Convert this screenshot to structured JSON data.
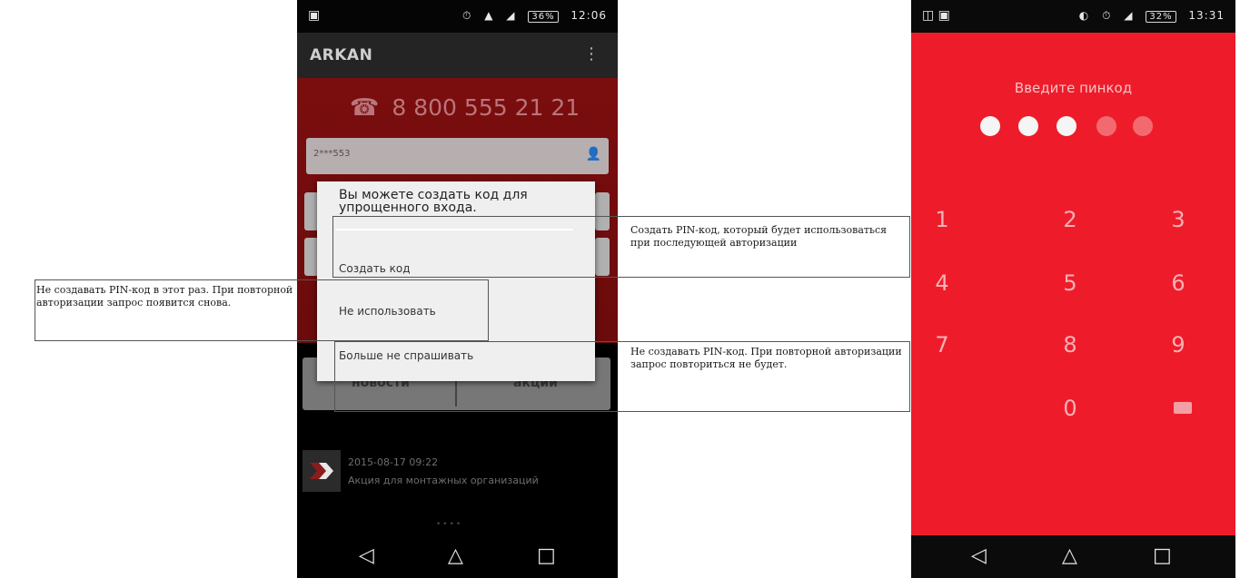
{
  "left_phone": {
    "status_bar": {
      "left_icon": "▣",
      "icons": [
        "⏱",
        "▲",
        "◢"
      ],
      "battery": "36%",
      "time": "12:06"
    },
    "app_bar": {
      "title": "ARKAN",
      "menu_icon": "⋮"
    },
    "phone_number": "8 800 555 21 21",
    "login_value": "2***553",
    "dialog": {
      "message": "Вы можете создать код для упрощенного входа.",
      "options": [
        "Создать код",
        "Не использовать",
        "Больше не спрашивать"
      ]
    },
    "tabs": [
      "новости",
      "акции"
    ],
    "news": {
      "date": "2015-08-17 09:22",
      "title": "Акция для монтажных организаций"
    },
    "page_dots": "••••",
    "nav": [
      "◁",
      "△",
      "□"
    ]
  },
  "annotations": {
    "create": "Создать PIN-код, который будет использоваться при последующей авторизации",
    "skip": "Не создавать PIN-код в этот раз. При повторной авторизации запрос появится снова.",
    "never": "Не создавать PIN-код. При повторной авторизации запрос повториться не будет."
  },
  "right_phone": {
    "status_bar": {
      "left_icon": "◫ ▣",
      "icons": [
        "◐",
        "⏱",
        "◢"
      ],
      "battery": "32%",
      "time": "13:31"
    },
    "pin_title": "Введите пинкод",
    "pin_filled": 3,
    "pin_length": 5,
    "keys": [
      "1",
      "2",
      "3",
      "4",
      "5",
      "6",
      "7",
      "8",
      "9",
      "0"
    ],
    "nav": [
      "◁",
      "△",
      "□"
    ],
    "colors": {
      "background": "#ee1c2a",
      "dot_filled": "#f5f5f5",
      "dot_empty": "#f26a6f"
    }
  }
}
